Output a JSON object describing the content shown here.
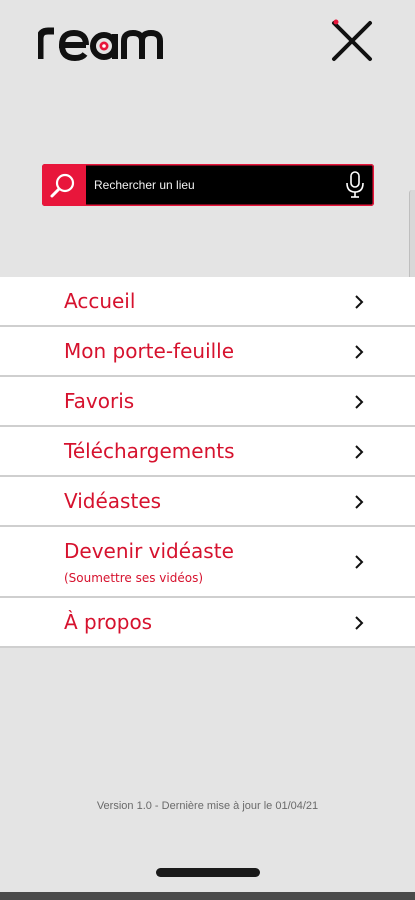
{
  "brand": {
    "logo_text": "ream",
    "accent_color": "#e8163b",
    "menu_text_color": "#d6122e"
  },
  "header": {
    "close_icon": "close-icon"
  },
  "search": {
    "placeholder": "Rechercher un lieu",
    "search_icon": "search-icon",
    "mic_icon": "microphone-icon"
  },
  "menu": {
    "items": [
      {
        "label": "Accueil"
      },
      {
        "label": "Mon porte-feuille"
      },
      {
        "label": "Favoris"
      },
      {
        "label": "Téléchargements"
      },
      {
        "label": "Vidéastes"
      },
      {
        "label": "Devenir vidéaste",
        "sublabel": "(Soumettre ses vidéos)"
      },
      {
        "label": "À propos"
      }
    ],
    "chevron_icon": "chevron-right-icon"
  },
  "footer": {
    "version": "Version 1.0 - Dernière mise à jour le 01/04/21"
  }
}
